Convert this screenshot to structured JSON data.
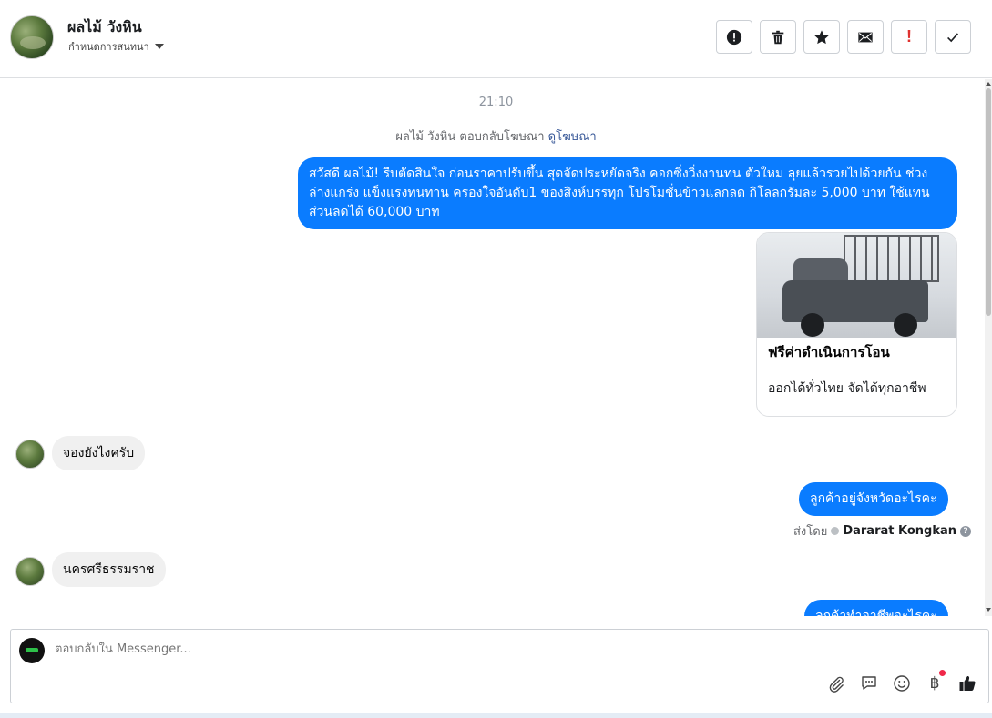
{
  "header": {
    "contact_name": "ผลไม้ วังหิน",
    "conversation_settings": "กำหนดการสนทนา",
    "actions": [
      {
        "name": "spam-button",
        "icon": "alert-circle-icon"
      },
      {
        "name": "delete-button",
        "icon": "trash-icon"
      },
      {
        "name": "star-button",
        "icon": "star-icon"
      },
      {
        "name": "mark-unread-button",
        "icon": "envelope-icon"
      },
      {
        "name": "follow-up-button",
        "icon": "exclamation-icon",
        "label": "!"
      },
      {
        "name": "mark-done-button",
        "icon": "check-icon"
      }
    ]
  },
  "thread": {
    "timestamp": "21:10",
    "ad_reply_prefix": "ผลไม้ วังหิน ตอบกลับโฆษณา",
    "ad_reply_link": "ดูโฆษณา",
    "messages": [
      {
        "direction": "out",
        "text": "สวัสดี ผลไม้! รีบตัดสินใจ ก่อนราคาปรับขึ้น สุดจัดประหยัดจริง คอกซิ่งวิ่งงานทน ตัวใหม่ ลุยแล้วรวยไปด้วยกัน ช่วงล่างแกร่ง แข็งแรงทนทาน ครองใจอันดับ1 ของสิงห์บรรทุก โปรโมชั่นข้าวแลกลด กิโลลกรัมละ 5,000 บาท ใช้แทนส่วนลดได้ 60,000 บาท"
      },
      {
        "direction": "in",
        "text": "จองยังไงครับ"
      },
      {
        "direction": "out",
        "text": "ลูกค้าอยู่จังหวัดอะไรคะ"
      },
      {
        "direction": "in",
        "text": "นครศรีธรรมราช"
      },
      {
        "direction": "out",
        "text": "ลูกค้าทำอาชีพอะไรคะ"
      }
    ],
    "ad_card": {
      "title": "ฟรีค่าดำเนินการโอน",
      "subtitle": "ออกได้ทั่วไทย จัดได้ทุกอาชีพ"
    },
    "sent_by_label": "ส่งโดย",
    "sent_by_name": "Dararat Kongkan"
  },
  "composer": {
    "placeholder": "ตอบกลับใน Messenger...",
    "tools": [
      "paperclip-icon",
      "chat-bubble-icon",
      "emoji-icon",
      "baht-icon",
      "thumbs-up-icon"
    ],
    "baht_symbol": "฿"
  },
  "colors": {
    "outgoing_bubble": "#0a7cff",
    "incoming_bubble": "#f0f0f0",
    "link": "#385898"
  }
}
